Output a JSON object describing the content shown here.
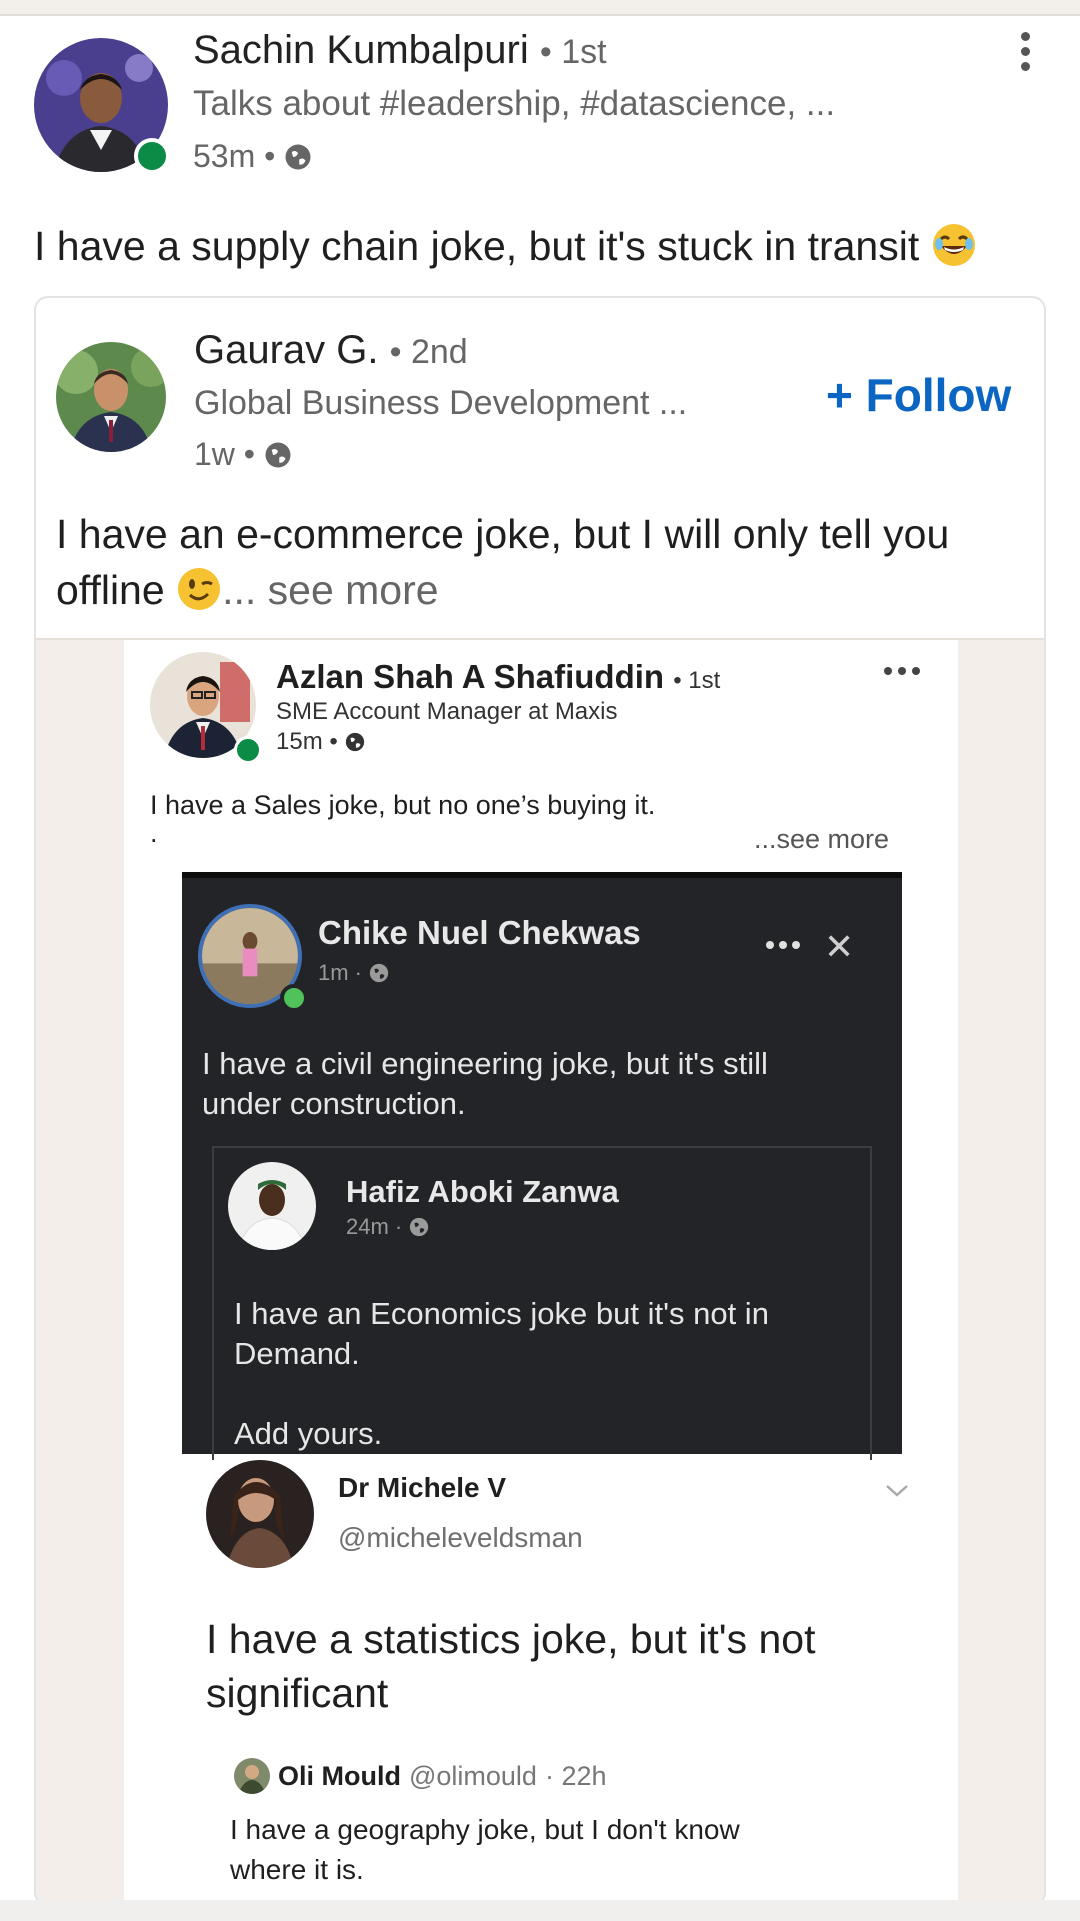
{
  "post": {
    "author": "Sachin Kumbalpuri",
    "degree": "• 1st",
    "headline": "Talks about #leadership, #datascience, ...",
    "time": "53m •",
    "text": "I have a supply chain joke, but it's stuck in transit"
  },
  "reshare": {
    "author": "Gaurav G.",
    "degree": "• 2nd",
    "headline": "Global Business Development ...",
    "time": "1w •",
    "follow_label": "+ Follow",
    "text": "I have an e-commerce joke, but I will only tell you offline",
    "see_more": "... see more"
  },
  "image": {
    "azlan": {
      "name": "Azlan Shah A Shafiuddin",
      "degree": "• 1st",
      "headline": "SME Account Manager at Maxis",
      "time": "15m •",
      "text": "I have a Sales joke, but no one’s buying it.",
      "dot": ".",
      "see_more": "...see more"
    },
    "chike": {
      "name": "Chike Nuel Chekwas",
      "time": "1m ·",
      "close": "✕",
      "text": "I have a civil engineering joke, but it's still under construction."
    },
    "hafiz": {
      "name": "Hafiz Aboki Zanwa",
      "time": "24m ·",
      "text": "I have an Economics joke but it's not in Demand.",
      "add": "Add yours."
    },
    "michele": {
      "name": "Dr Michele V",
      "handle": "@micheleveldsman",
      "text": "I have a statistics joke, but it's not significant"
    },
    "oli": {
      "name": "Oli Mould",
      "handle": "@olimould",
      "time": "· 22h",
      "text": "I have a geography joke, but I don't know where it is."
    }
  },
  "colors": {
    "link_blue": "#0a66c2",
    "online_green": "#0a8b46",
    "dark_panel": "#232427"
  },
  "icons": [
    "globe-icon",
    "kebab-menu-icon",
    "more-dots-icon",
    "close-icon",
    "chevron-down-icon",
    "laughing-emoji-icon",
    "winking-emoji-icon"
  ]
}
